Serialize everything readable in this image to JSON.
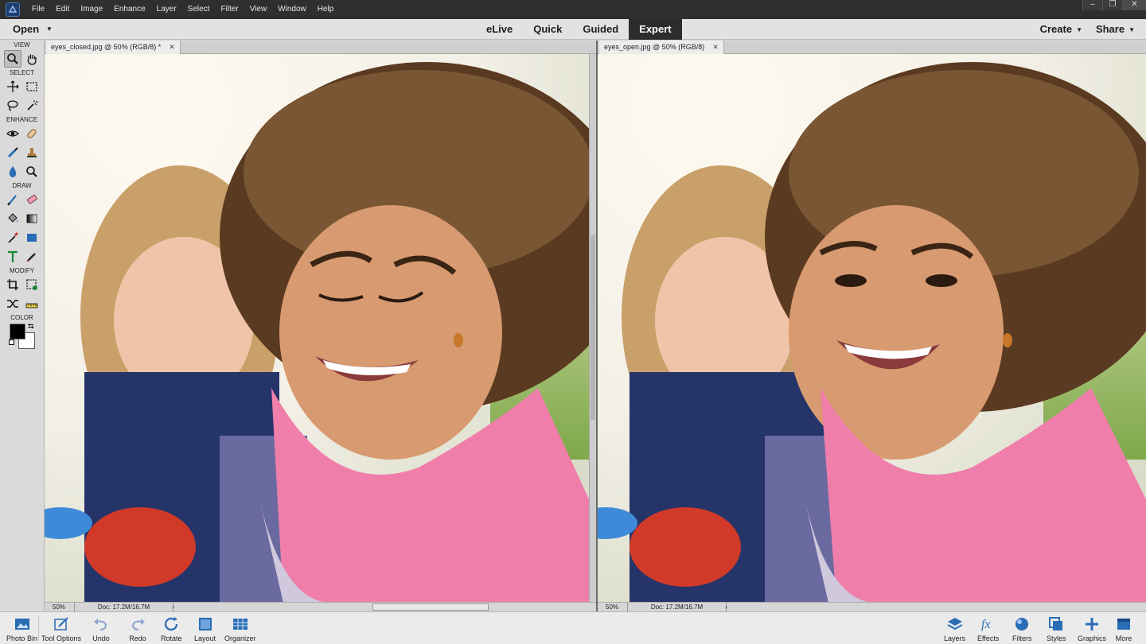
{
  "menubar": {
    "items": [
      "File",
      "Edit",
      "Image",
      "Enhance",
      "Layer",
      "Select",
      "Filter",
      "View",
      "Window",
      "Help"
    ],
    "window_controls": [
      "‒",
      "❐",
      "✕"
    ]
  },
  "modebar": {
    "open_label": "Open",
    "modes": [
      "eLive",
      "Quick",
      "Guided",
      "Expert"
    ],
    "active_mode": "Expert",
    "create_label": "Create",
    "share_label": "Share"
  },
  "toolbox": {
    "sections": {
      "view": "VIEW",
      "select": "SELECT",
      "enhance": "ENHANCE",
      "draw": "DRAW",
      "modify": "MODIFY",
      "color": "COLOR"
    },
    "foreground_color": "#000000",
    "background_color": "#ffffff"
  },
  "documents": {
    "left": {
      "tab_title": "eyes_closed.jpg @ 50% (RGB/8) *",
      "zoom": "50%",
      "doc_size": "Doc: 17.2M/16.7M"
    },
    "right": {
      "tab_title": "eyes_open.jpg @ 50% (RGB/8)",
      "zoom": "50%",
      "doc_size": "Doc: 17.2M/16.7M"
    }
  },
  "bottombar": {
    "left": [
      "Photo Bin",
      "Tool Options",
      "Undo",
      "Redo",
      "Rotate",
      "Layout",
      "Organizer"
    ],
    "right": [
      "Layers",
      "Effects",
      "Filters",
      "Styles",
      "Graphics",
      "More"
    ]
  },
  "colors": {
    "accent_blue": "#2a6db5",
    "menubar_bg": "#2f2f2f",
    "active_mode_bg": "#2c2c2c"
  }
}
